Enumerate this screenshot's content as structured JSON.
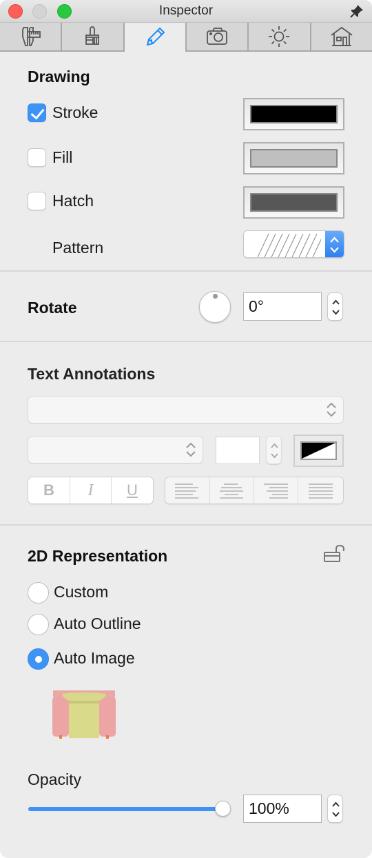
{
  "window": {
    "title": "Inspector"
  },
  "tabs": [
    {
      "name": "dimensions",
      "icon": "caliper-icon",
      "active": false
    },
    {
      "name": "materials",
      "icon": "brush-icon",
      "active": false
    },
    {
      "name": "drawing",
      "icon": "pencil-icon",
      "active": true
    },
    {
      "name": "camera",
      "icon": "camera-icon",
      "active": false
    },
    {
      "name": "light",
      "icon": "sun-icon",
      "active": false
    },
    {
      "name": "building",
      "icon": "house-icon",
      "active": false
    }
  ],
  "drawing": {
    "title": "Drawing",
    "stroke": {
      "label": "Stroke",
      "checked": true,
      "color": "#000000"
    },
    "fill": {
      "label": "Fill",
      "checked": false,
      "color": "#bfbfbf"
    },
    "hatch": {
      "label": "Hatch",
      "checked": false,
      "color": "#575757"
    },
    "pattern": {
      "label": "Pattern"
    }
  },
  "rotate": {
    "title": "Rotate",
    "value": "0°"
  },
  "text_annotations": {
    "title": "Text Annotations",
    "font_family": "",
    "font_style": "",
    "font_size": "",
    "styles": [
      "B",
      "I",
      "U"
    ],
    "alignments": [
      "left",
      "center",
      "right",
      "justify"
    ]
  },
  "representation_2d": {
    "title": "2D Representation",
    "options": [
      {
        "label": "Custom",
        "selected": false
      },
      {
        "label": "Auto Outline",
        "selected": false
      },
      {
        "label": "Auto Image",
        "selected": true
      }
    ],
    "opacity": {
      "label": "Opacity",
      "value": "100%",
      "fraction": 1.0
    }
  },
  "colors": {
    "accent": "#3d94f6"
  }
}
